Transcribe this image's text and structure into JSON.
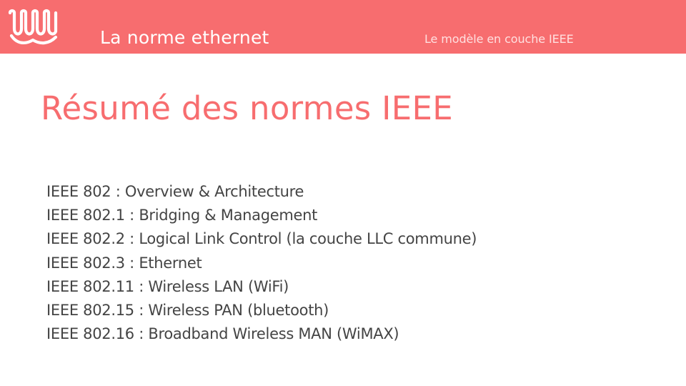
{
  "header": {
    "title": "La norme ethernet",
    "subtitle": "Le modèle en couche IEEE",
    "logo_icon": "wave-logo-icon",
    "background_color": "#f76d6f"
  },
  "slide": {
    "title": "Résumé des normes IEEE",
    "title_color": "#f76d6f",
    "items": [
      "IEEE 802 : Overview & Architecture",
      "IEEE 802.1 : Bridging & Management",
      "IEEE 802.2 : Logical Link Control (la couche LLC commune)",
      "IEEE 802.3 : Ethernet",
      "IEEE 802.11 : Wireless LAN (WiFi)",
      "IEEE 802.15 : Wireless PAN (bluetooth)",
      "IEEE 802.16 : Broadband Wireless MAN (WiMAX)"
    ]
  }
}
